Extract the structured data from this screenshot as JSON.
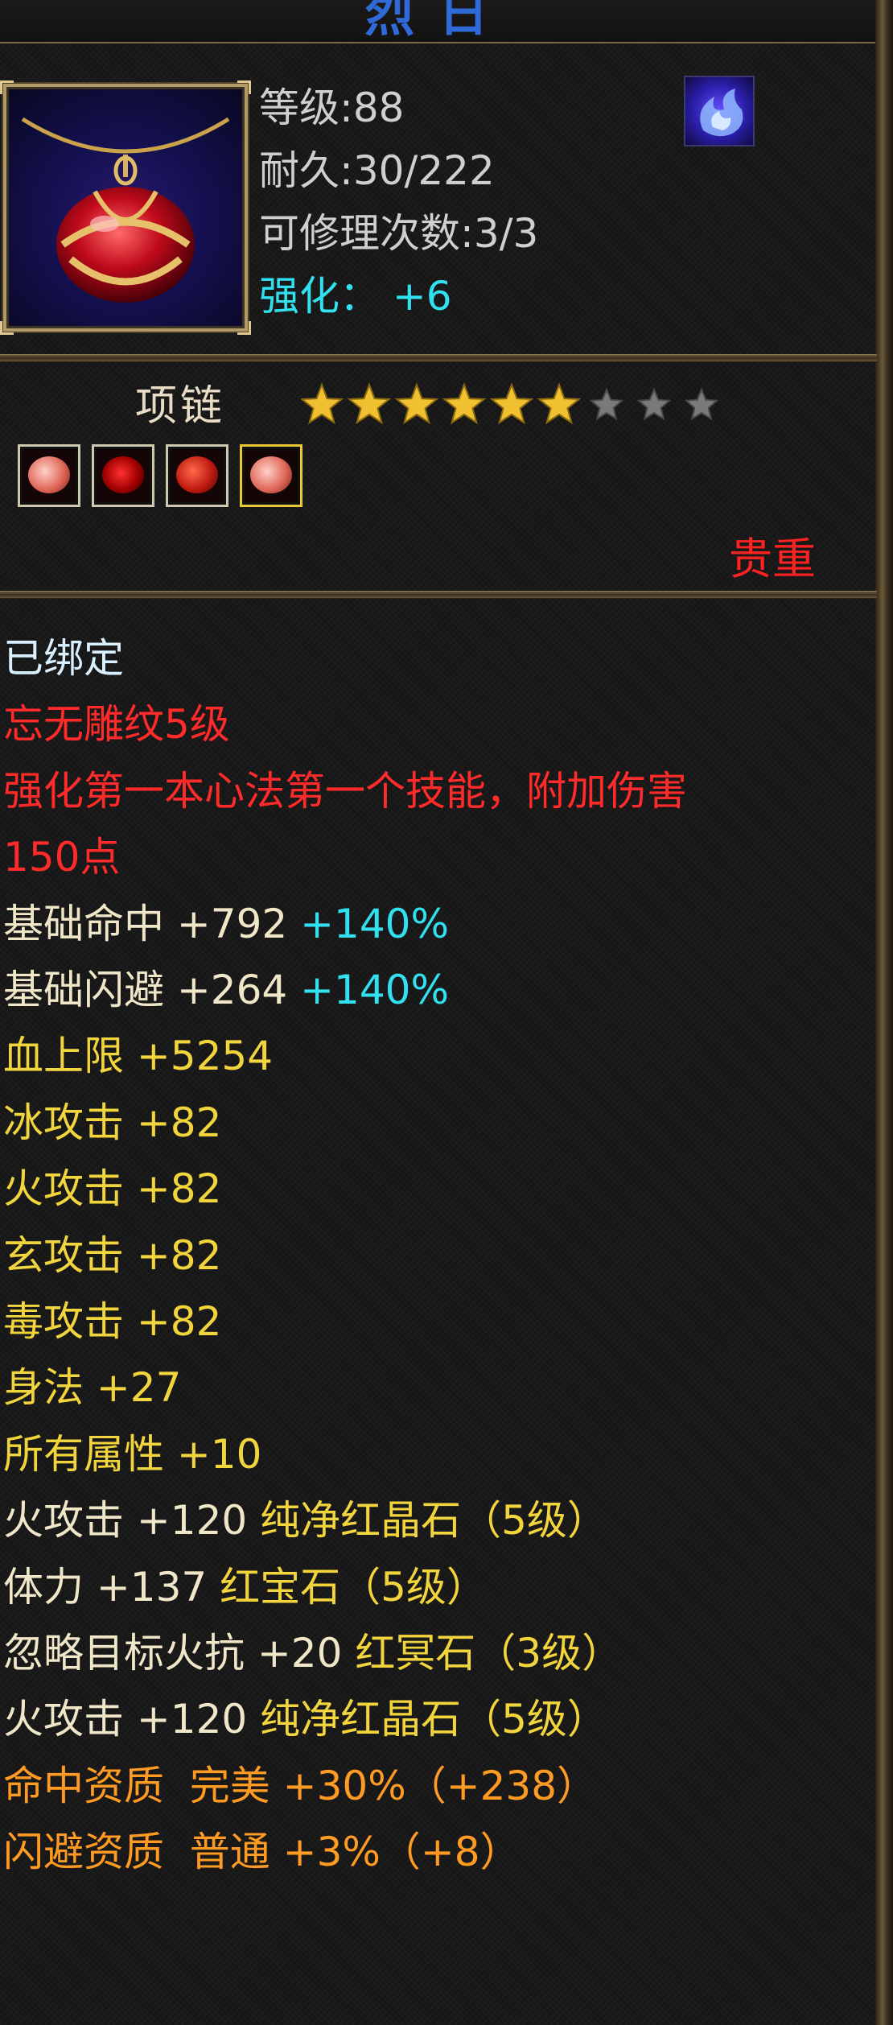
{
  "title": "烈日",
  "item": {
    "level_label": "等级",
    "level": "88",
    "durability_label": "耐久",
    "durability": "30/222",
    "repair_label": "可修理次数",
    "repair": "3/3",
    "enhance_label": "强化：",
    "enhance": "+6",
    "type": "项链",
    "stars_filled": 6,
    "stars_total": 9,
    "rarity": "贵重",
    "icon": "necklace-red-gem-icon",
    "skill_icon": "blue-flame-icon"
  },
  "gems": [
    {
      "icon": "pink-gem-icon",
      "selected": false
    },
    {
      "icon": "red-crystal-icon",
      "selected": false
    },
    {
      "icon": "red-ruby-icon",
      "selected": false
    },
    {
      "icon": "pink-gem-icon",
      "selected": true
    }
  ],
  "attributes": [
    {
      "parts": [
        {
          "text": "已绑定",
          "color": "#d8f0ff"
        }
      ]
    },
    {
      "parts": [
        {
          "text": "忘无雕纹5级",
          "color": "#ff2a2a"
        }
      ]
    },
    {
      "parts": [
        {
          "text": "强化第一本心法第一个技能，附加伤害",
          "color": "#ff2a2a"
        }
      ]
    },
    {
      "parts": [
        {
          "text": "150点",
          "color": "#ff2a2a"
        }
      ]
    },
    {
      "parts": [
        {
          "text": "基础命中 +792 ",
          "color": "#f0e6c8"
        },
        {
          "text": "+140%",
          "color": "#31e1f0"
        }
      ]
    },
    {
      "parts": [
        {
          "text": "基础闪避 +264 ",
          "color": "#f0e6c8"
        },
        {
          "text": "+140%",
          "color": "#31e1f0"
        }
      ]
    },
    {
      "parts": [
        {
          "text": "血上限 +5254",
          "color": "#f2d53c"
        }
      ]
    },
    {
      "parts": [
        {
          "text": "冰攻击 +82",
          "color": "#f2d53c"
        }
      ]
    },
    {
      "parts": [
        {
          "text": "火攻击 +82",
          "color": "#f2d53c"
        }
      ]
    },
    {
      "parts": [
        {
          "text": "玄攻击 +82",
          "color": "#f2d53c"
        }
      ]
    },
    {
      "parts": [
        {
          "text": "毒攻击 +82",
          "color": "#f2d53c"
        }
      ]
    },
    {
      "parts": [
        {
          "text": "身法 +27",
          "color": "#f2d53c"
        }
      ]
    },
    {
      "parts": [
        {
          "text": "所有属性 +10",
          "color": "#f2d53c"
        }
      ]
    },
    {
      "parts": [
        {
          "text": "火攻击 +120 ",
          "color": "#f0e6c8"
        },
        {
          "text": "纯净红晶石（5级）",
          "color": "#f2d53c"
        }
      ]
    },
    {
      "parts": [
        {
          "text": "体力 +137 ",
          "color": "#f0e6c8"
        },
        {
          "text": "红宝石（5级）",
          "color": "#f2d53c"
        }
      ]
    },
    {
      "parts": [
        {
          "text": "忽略目标火抗 +20 ",
          "color": "#f0e6c8"
        },
        {
          "text": "红冥石（3级）",
          "color": "#f2d53c"
        }
      ]
    },
    {
      "parts": [
        {
          "text": "火攻击 +120 ",
          "color": "#f0e6c8"
        },
        {
          "text": "纯净红晶石（5级）",
          "color": "#f2d53c"
        }
      ]
    },
    {
      "parts": [
        {
          "text": "命中资质  完美 +30%（+238）",
          "color": "#ff9a22"
        }
      ]
    },
    {
      "parts": [
        {
          "text": "闪避资质  普通 +3%（+8）",
          "color": "#ff9a22"
        }
      ]
    }
  ]
}
